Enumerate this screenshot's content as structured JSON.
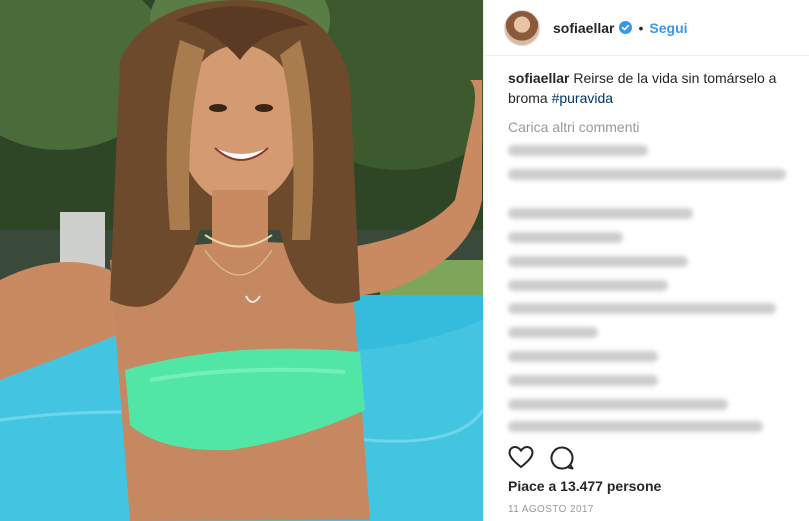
{
  "post": {
    "username": "sofiaellar",
    "dot": "•",
    "follow_label": "Segui",
    "caption_user": "sofiaellar",
    "caption_text": " Reirse de la vida sin tomárselo a broma ",
    "caption_hashtag": "#puravida",
    "load_more_label": "Carica altri commenti",
    "likes_text": "Piace a 13.477 persone",
    "date_text": "11 AGOSTO 2017"
  },
  "icons": {
    "verified": "verified-badge-icon",
    "like": "heart-icon",
    "comment": "comment-icon"
  },
  "colors": {
    "link_blue": "#3897f0",
    "hashtag": "#003569",
    "muted": "#999999",
    "text": "#262626"
  }
}
